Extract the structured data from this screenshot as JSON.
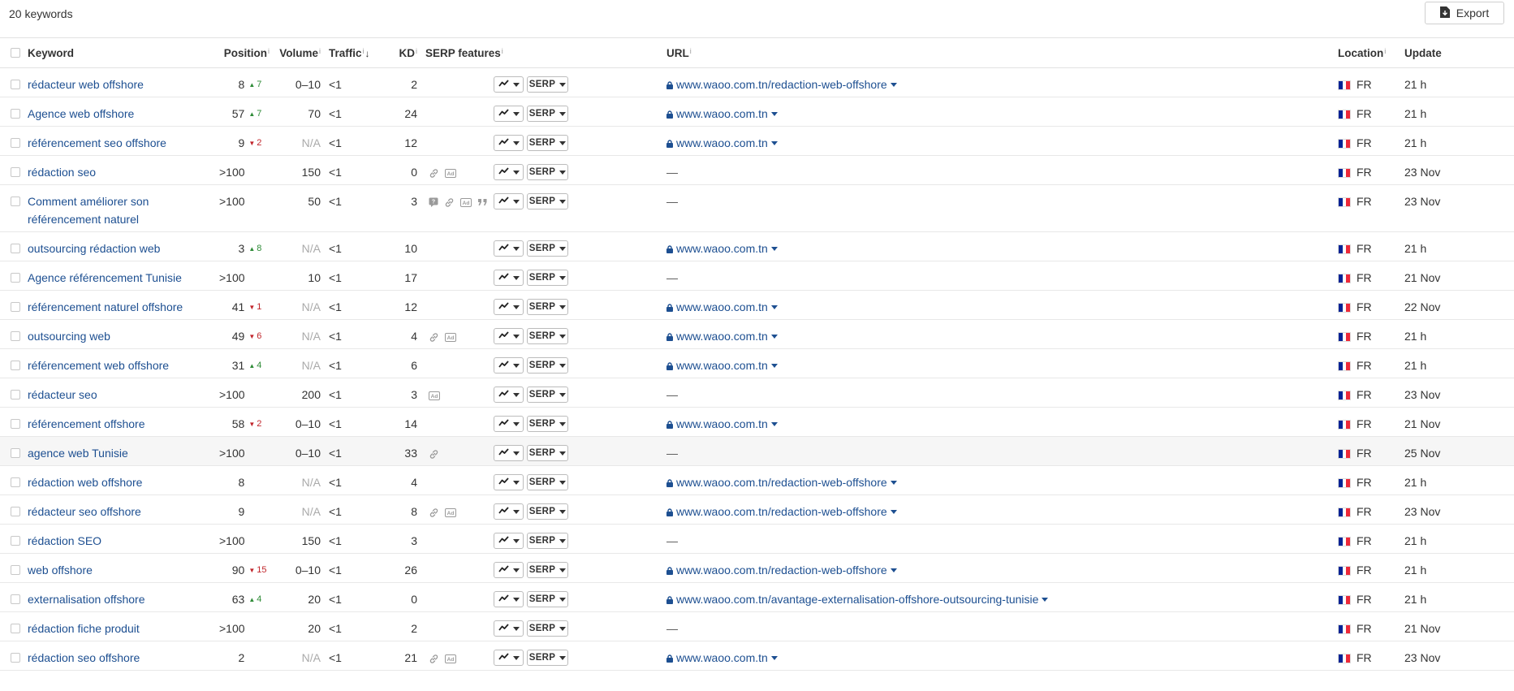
{
  "header": {
    "keyword_count": "20 keywords",
    "export_label": "Export"
  },
  "columns": {
    "keyword": "Keyword",
    "position": "Position",
    "volume": "Volume",
    "traffic": "Traffic",
    "kd": "KD",
    "serp_features": "SERP features",
    "url": "URL",
    "location": "Location",
    "update": "Update",
    "info_mark": "i"
  },
  "serp_button_label": "SERP",
  "colors": {
    "link": "#1d4f91",
    "up": "#2e8b37",
    "down": "#c0242a",
    "flag_blue": "#002395",
    "flag_white": "#ffffff",
    "flag_red": "#ED2939"
  },
  "rows": [
    {
      "keyword": "rédacteur web offshore",
      "position": "8",
      "change": "7",
      "dir": "up",
      "volume": "0–10",
      "traffic": "<1",
      "kd": "2",
      "features": [],
      "url": "www.waoo.com.tn/redaction-web-offshore",
      "location": "FR",
      "update": "21 h"
    },
    {
      "keyword": "Agence web offshore",
      "position": "57",
      "change": "7",
      "dir": "up",
      "volume": "70",
      "traffic": "<1",
      "kd": "24",
      "features": [],
      "url": "www.waoo.com.tn",
      "location": "FR",
      "update": "21 h"
    },
    {
      "keyword": "référencement seo offshore",
      "position": "9",
      "change": "2",
      "dir": "down",
      "volume": "N/A",
      "traffic": "<1",
      "kd": "12",
      "features": [],
      "url": "www.waoo.com.tn",
      "location": "FR",
      "update": "21 h"
    },
    {
      "keyword": "rédaction seo",
      "position": ">100",
      "change": "",
      "dir": "",
      "volume": "150",
      "traffic": "<1",
      "kd": "0",
      "features": [
        "link-icon",
        "ad-icon"
      ],
      "url": "—",
      "location": "FR",
      "update": "23 Nov"
    },
    {
      "keyword": "Comment améliorer son référencement naturel",
      "position": ">100",
      "change": "",
      "dir": "",
      "volume": "50",
      "traffic": "<1",
      "kd": "3",
      "features": [
        "faq-icon",
        "link-icon",
        "ad-icon",
        "quote-icon"
      ],
      "url": "—",
      "location": "FR",
      "update": "23 Nov"
    },
    {
      "keyword": "outsourcing rédaction web",
      "position": "3",
      "change": "8",
      "dir": "up",
      "volume": "N/A",
      "traffic": "<1",
      "kd": "10",
      "features": [],
      "url": "www.waoo.com.tn",
      "location": "FR",
      "update": "21 h"
    },
    {
      "keyword": "Agence référencement Tunisie",
      "position": ">100",
      "change": "",
      "dir": "",
      "volume": "10",
      "traffic": "<1",
      "kd": "17",
      "features": [],
      "url": "—",
      "location": "FR",
      "update": "21 Nov"
    },
    {
      "keyword": "référencement naturel offshore",
      "position": "41",
      "change": "1",
      "dir": "down",
      "volume": "N/A",
      "traffic": "<1",
      "kd": "12",
      "features": [],
      "url": "www.waoo.com.tn",
      "location": "FR",
      "update": "22 Nov"
    },
    {
      "keyword": "outsourcing web",
      "position": "49",
      "change": "6",
      "dir": "down",
      "volume": "N/A",
      "traffic": "<1",
      "kd": "4",
      "features": [
        "link-icon",
        "ad-icon"
      ],
      "url": "www.waoo.com.tn",
      "location": "FR",
      "update": "21 h"
    },
    {
      "keyword": "référencement web offshore",
      "position": "31",
      "change": "4",
      "dir": "up",
      "volume": "N/A",
      "traffic": "<1",
      "kd": "6",
      "features": [],
      "url": "www.waoo.com.tn",
      "location": "FR",
      "update": "21 h"
    },
    {
      "keyword": "rédacteur seo",
      "position": ">100",
      "change": "",
      "dir": "",
      "volume": "200",
      "traffic": "<1",
      "kd": "3",
      "features": [
        "ad-icon"
      ],
      "url": "—",
      "location": "FR",
      "update": "23 Nov"
    },
    {
      "keyword": "référencement offshore",
      "position": "58",
      "change": "2",
      "dir": "down",
      "volume": "0–10",
      "traffic": "<1",
      "kd": "14",
      "features": [],
      "url": "www.waoo.com.tn",
      "location": "FR",
      "update": "21 Nov"
    },
    {
      "keyword": "agence web Tunisie",
      "position": ">100",
      "change": "",
      "dir": "",
      "volume": "0–10",
      "traffic": "<1",
      "kd": "33",
      "features": [
        "link-icon"
      ],
      "url": "—",
      "location": "FR",
      "update": "25 Nov"
    },
    {
      "keyword": "rédaction web offshore",
      "position": "8",
      "change": "",
      "dir": "",
      "volume": "N/A",
      "traffic": "<1",
      "kd": "4",
      "features": [],
      "url": "www.waoo.com.tn/redaction-web-offshore",
      "location": "FR",
      "update": "21 h"
    },
    {
      "keyword": "rédacteur seo offshore",
      "position": "9",
      "change": "",
      "dir": "",
      "volume": "N/A",
      "traffic": "<1",
      "kd": "8",
      "features": [
        "link-icon",
        "ad-icon"
      ],
      "url": "www.waoo.com.tn/redaction-web-offshore",
      "location": "FR",
      "update": "23 Nov"
    },
    {
      "keyword": "rédaction SEO",
      "position": ">100",
      "change": "",
      "dir": "",
      "volume": "150",
      "traffic": "<1",
      "kd": "3",
      "features": [],
      "url": "—",
      "location": "FR",
      "update": "21 h"
    },
    {
      "keyword": "web offshore",
      "position": "90",
      "change": "15",
      "dir": "down",
      "volume": "0–10",
      "traffic": "<1",
      "kd": "26",
      "features": [],
      "url": "www.waoo.com.tn/redaction-web-offshore",
      "location": "FR",
      "update": "21 h"
    },
    {
      "keyword": "externalisation offshore",
      "position": "63",
      "change": "4",
      "dir": "up",
      "volume": "20",
      "traffic": "<1",
      "kd": "0",
      "features": [],
      "url": "www.waoo.com.tn/avantage-externalisation-offshore-outsourcing-tunisie",
      "location": "FR",
      "update": "21 h"
    },
    {
      "keyword": "rédaction fiche produit",
      "position": ">100",
      "change": "",
      "dir": "",
      "volume": "20",
      "traffic": "<1",
      "kd": "2",
      "features": [],
      "url": "—",
      "location": "FR",
      "update": "21 Nov"
    },
    {
      "keyword": "rédaction seo offshore",
      "position": "2",
      "change": "",
      "dir": "",
      "volume": "N/A",
      "traffic": "<1",
      "kd": "21",
      "features": [
        "link-icon",
        "ad-icon"
      ],
      "url": "www.waoo.com.tn",
      "location": "FR",
      "update": "23 Nov"
    }
  ]
}
